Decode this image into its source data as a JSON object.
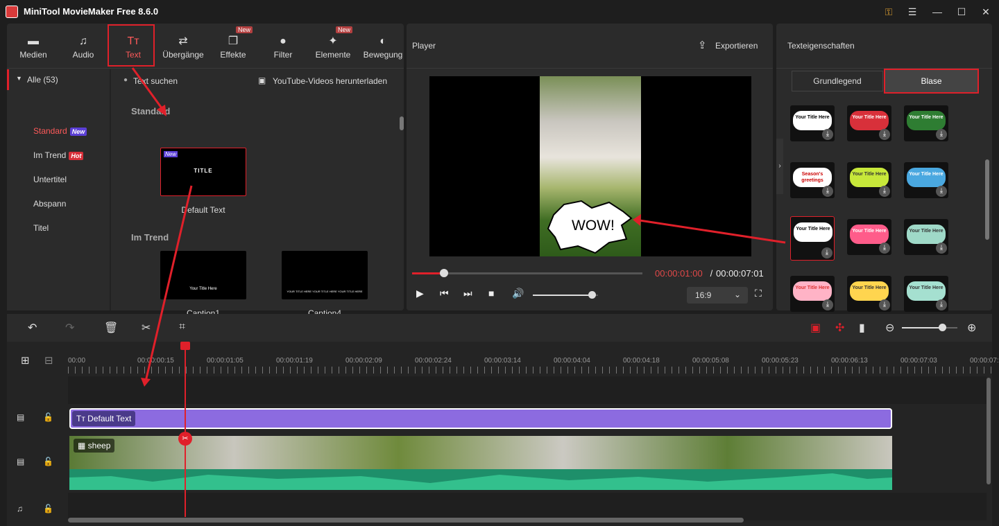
{
  "app": {
    "title": "MiniTool MovieMaker Free 8.6.0"
  },
  "toolbar": [
    {
      "label": "Medien",
      "icon": "folder-icon"
    },
    {
      "label": "Audio",
      "icon": "music-note-icon"
    },
    {
      "label": "Text",
      "icon": "text-icon",
      "active": true
    },
    {
      "label": "Übergänge",
      "icon": "transition-icon"
    },
    {
      "label": "Effekte",
      "icon": "effects-icon",
      "new": "New"
    },
    {
      "label": "Filter",
      "icon": "filter-icon"
    },
    {
      "label": "Elemente",
      "icon": "elements-icon",
      "new": "New"
    },
    {
      "label": "Bewegung",
      "icon": "motion-icon"
    }
  ],
  "categories": {
    "header": "Alle (53)",
    "items": [
      {
        "label": "Standard",
        "badge": "New",
        "badge_color": "#5b3fd6",
        "active": true
      },
      {
        "label": "Im Trend",
        "badge": "Hot",
        "badge_color": "#d8303a"
      },
      {
        "label": "Untertitel"
      },
      {
        "label": "Abspann"
      },
      {
        "label": "Titel"
      }
    ]
  },
  "content": {
    "search_placeholder": "Text suchen",
    "youtube_link": "YouTube-Videos herunterladen",
    "section_standard": "Standard",
    "section_trend": "Im Trend",
    "default_thumb_badge": "New",
    "default_thumb_title": "TITLE",
    "default_label": "Default Text",
    "caption1_label": "Caption1",
    "caption1_text": "Your Title Here",
    "caption4_label": "Caption4",
    "caption4_text": "YOUR TITLE HERE YOUR TITLE HERE YOUR TITLE HERE"
  },
  "player": {
    "title": "Player",
    "export_label": "Exportieren",
    "bubble_text": "WOW!",
    "current_time": "00:00:01:00",
    "separator": " / ",
    "total_time": "00:00:07:01",
    "aspect": "16:9",
    "progress": 0.14,
    "volume": 0.9
  },
  "props": {
    "title": "Texteigenschaften",
    "tab_basic": "Grundlegend",
    "tab_bubble": "Blase",
    "tiles": [
      {
        "text": "Your Title Here",
        "bg": "#ffffff",
        "fg": "#000"
      },
      {
        "text": "Your Title Here",
        "bg": "#d8303a",
        "fg": "#fff"
      },
      {
        "text": "Your Title Here",
        "bg": "#2e7d32",
        "fg": "#fff"
      },
      {
        "text": "Season's greetings",
        "bg": "#ffffff",
        "fg": "#c00"
      },
      {
        "text": "Your Title Here",
        "bg": "#c7e83a",
        "fg": "#333"
      },
      {
        "text": "Your Title Here",
        "bg": "#4aa8e0",
        "fg": "#fff"
      },
      {
        "text": "Your Title Here",
        "bg": "#ffffff",
        "fg": "#000",
        "selected": true
      },
      {
        "text": "Your Title Here",
        "bg": "#ff5c8a",
        "fg": "#fff"
      },
      {
        "text": "Your Title Here",
        "bg": "#9fd9c8",
        "fg": "#333"
      },
      {
        "text": "Your Title Here",
        "bg": "#ffb3c6",
        "fg": "#d33"
      },
      {
        "text": "Your Title Here",
        "bg": "#ffd54f",
        "fg": "#333"
      },
      {
        "text": "Your Title Here",
        "bg": "#a5e0d0",
        "fg": "#333"
      }
    ]
  },
  "timeline": {
    "ticks": [
      "00:00",
      "00:00:00:15",
      "00:00:01:05",
      "00:00:01:19",
      "00:00:02:09",
      "00:00:02:24",
      "00:00:03:14",
      "00:00:04:04",
      "00:00:04:18",
      "00:00:05:08",
      "00:00:05:23",
      "00:00:06:13",
      "00:00:07:03",
      "00:00:07:1"
    ],
    "text_clip": "Default Text",
    "video_clip": "sheep",
    "zoom": 0.72
  }
}
